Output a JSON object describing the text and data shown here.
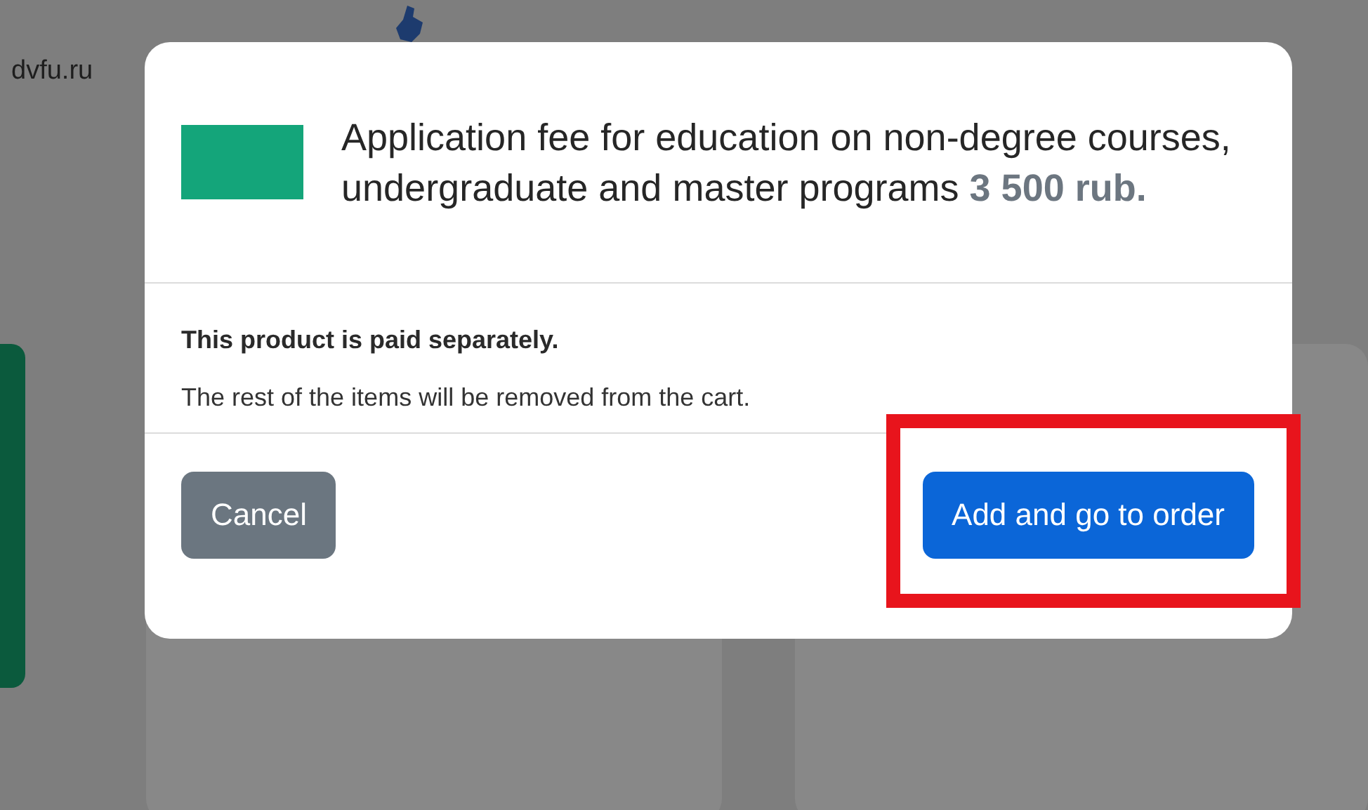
{
  "page": {
    "site_text": "dvfu.ru"
  },
  "modal": {
    "product_title": "Application fee for education on non-degree courses, undergraduate and master programs",
    "price": "3 500 rub.",
    "notice": "This product is paid separately.",
    "message": "The rest of the items will be removed from the cart.",
    "buttons": [
      {
        "label": "Cancel",
        "kind": "secondary",
        "highlighted": false
      },
      {
        "label": "Add and go to order",
        "kind": "primary",
        "highlighted": true
      }
    ]
  }
}
